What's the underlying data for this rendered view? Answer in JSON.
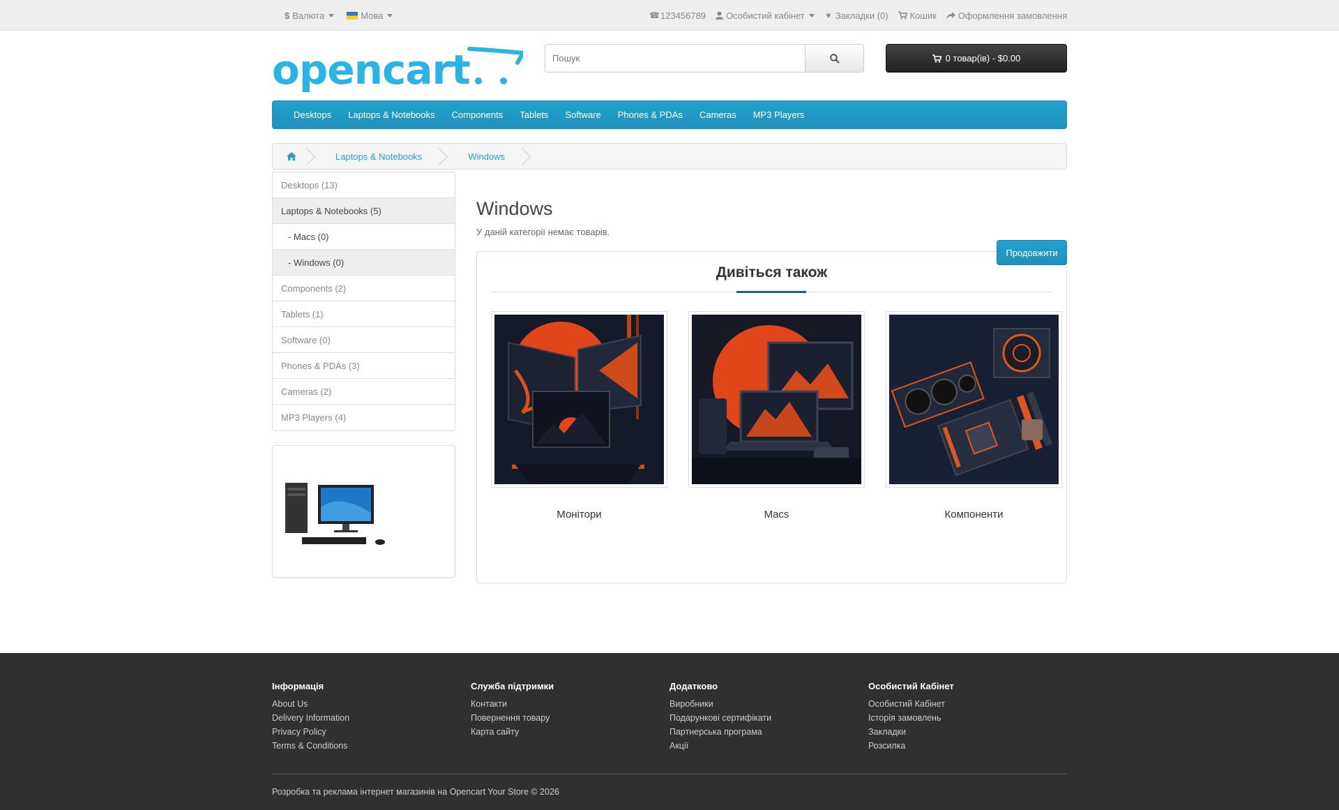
{
  "topbar": {
    "currency_label": "Валюта",
    "language_label": "Мова",
    "phone": "123456789",
    "account": "Особистий кабінет",
    "wishlist": "Закладки (0)",
    "cart": "Кошик",
    "checkout": "Оформлення замовлення",
    "currency_symbol": "$"
  },
  "header": {
    "logo_text": "opencart",
    "search_placeholder": "Пошук",
    "cart_button": "0 товар(ів) - $0.00"
  },
  "menu": {
    "items": [
      "Desktops",
      "Laptops & Notebooks",
      "Components",
      "Tablets",
      "Software",
      "Phones & PDAs",
      "Cameras",
      "MP3 Players"
    ]
  },
  "breadcrumb": {
    "items": [
      "Laptops & Notebooks",
      "Windows"
    ]
  },
  "sidebar": {
    "categories": [
      "Desktops (13)",
      "Laptops & Notebooks (5)",
      "- Macs (0)",
      "- Windows (0)",
      "Components (2)",
      "Tablets (1)",
      "Software (0)",
      "Phones & PDAs (3)",
      "Cameras (2)",
      "MP3 Players (4)"
    ]
  },
  "content": {
    "title": "Windows",
    "empty_message": "У даній категорії немає товарів.",
    "continue_button": "Продовжити",
    "see_also_title": "Дивіться також",
    "see_also_items": [
      "Монітори",
      "Macs",
      "Компоненти"
    ]
  },
  "footer": {
    "col1": {
      "title": "Інформація",
      "links": [
        "About Us",
        "Delivery Information",
        "Privacy Policy",
        "Terms & Conditions"
      ]
    },
    "col2": {
      "title": "Служба підтримки",
      "links": [
        "Контакти",
        "Повернення товару",
        "Карта сайту"
      ]
    },
    "col3": {
      "title": "Додатково",
      "links": [
        "Виробники",
        "Подарункові сертифікати",
        "Партнерська програма",
        "Акції"
      ]
    },
    "col4": {
      "title": "Особистий Кабінет",
      "links": [
        "Особистий Кабінет",
        "Історія замовлень",
        "Закладки",
        "Розсилка"
      ]
    },
    "copyright": "Розробка та реклама інтернет магазинів на Opencart Your Store © 2026"
  },
  "colors": {
    "accent": "#23a1d1",
    "footer_bg": "#303030",
    "cart_bg": "#222222"
  }
}
